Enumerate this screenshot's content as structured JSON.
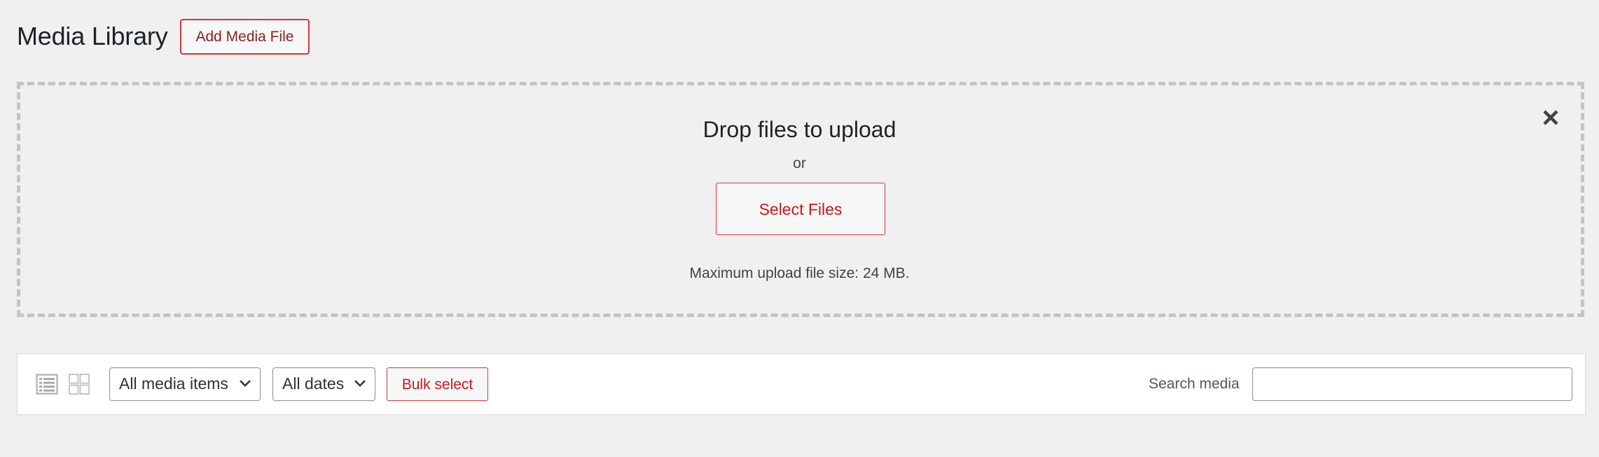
{
  "header": {
    "title": "Media Library",
    "add_button_label": "Add Media File"
  },
  "uploader": {
    "title": "Drop files to upload",
    "or_text": "or",
    "select_button_label": "Select Files",
    "max_size_text": "Maximum upload file size: 24 MB.",
    "close_icon": "close-icon"
  },
  "toolbar": {
    "view_modes": [
      {
        "icon": "list-view-icon",
        "active": false
      },
      {
        "icon": "grid-view-icon",
        "active": true
      }
    ],
    "type_filter": {
      "selected": "All media items"
    },
    "date_filter": {
      "selected": "All dates"
    },
    "bulk_select_label": "Bulk select",
    "search_label": "Search media",
    "search_value": ""
  },
  "colors": {
    "background": "#f0f0f1",
    "accent_red": "#d63638",
    "text_red": "#cc1818",
    "dashed_border": "#c3c4c7"
  }
}
